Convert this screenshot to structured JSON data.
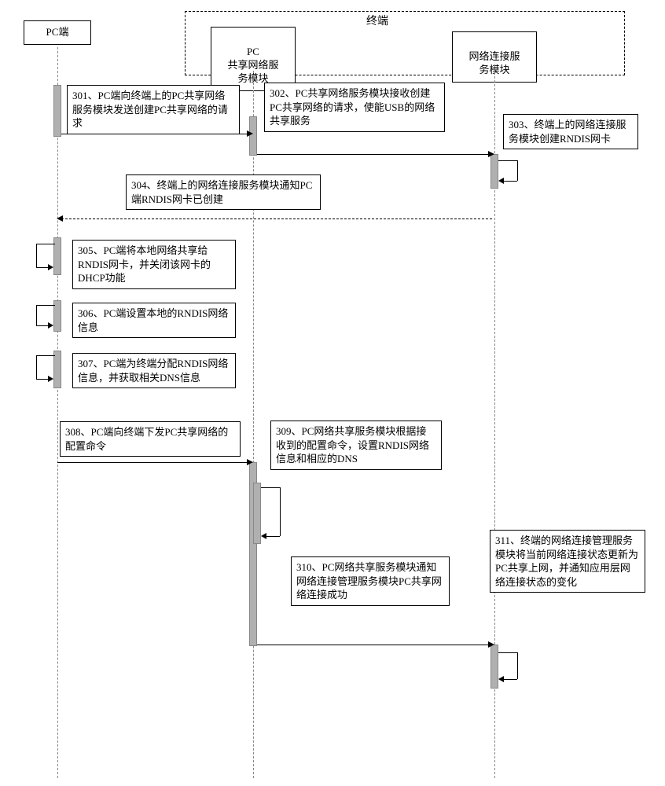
{
  "terminal_label": "终端",
  "participants": {
    "pc": "PC端",
    "pc_share": "PC\n共享网络服\n务模块",
    "net_conn": "网络连接服\n务模块"
  },
  "messages": {
    "s301": "301、PC端向终端上的PC共享网络服务模块发送创建PC共享网络的请求",
    "s302": "302、PC共享网络服务模块接收创建PC共享网络的请求，使能USB的网络共享服务",
    "s303": "303、终端上的网络连接服务模块创建RNDIS网卡",
    "s304": "304、终端上的网络连接服务模块通知PC端RNDIS网卡已创建",
    "s305": "305、PC端将本地网络共享给RNDIS网卡，并关闭该网卡的DHCP功能",
    "s306": "306、PC端设置本地的RNDIS网络信息",
    "s307": "307、PC端为终端分配RNDIS网络信息，并获取相关DNS信息",
    "s308": "308、PC端向终端下发PC共享网络的配置命令",
    "s309": "309、PC网络共享服务模块根据接收到的配置命令，设置RNDIS网络信息和相应的DNS",
    "s310": "310、PC网络共享服务模块通知网络连接管理服务模块PC共享网络连接成功",
    "s311": "311、终端的网络连接管理服务模块将当前网络连接状态更新为PC共享上网，并通知应用层网络连接状态的变化"
  }
}
